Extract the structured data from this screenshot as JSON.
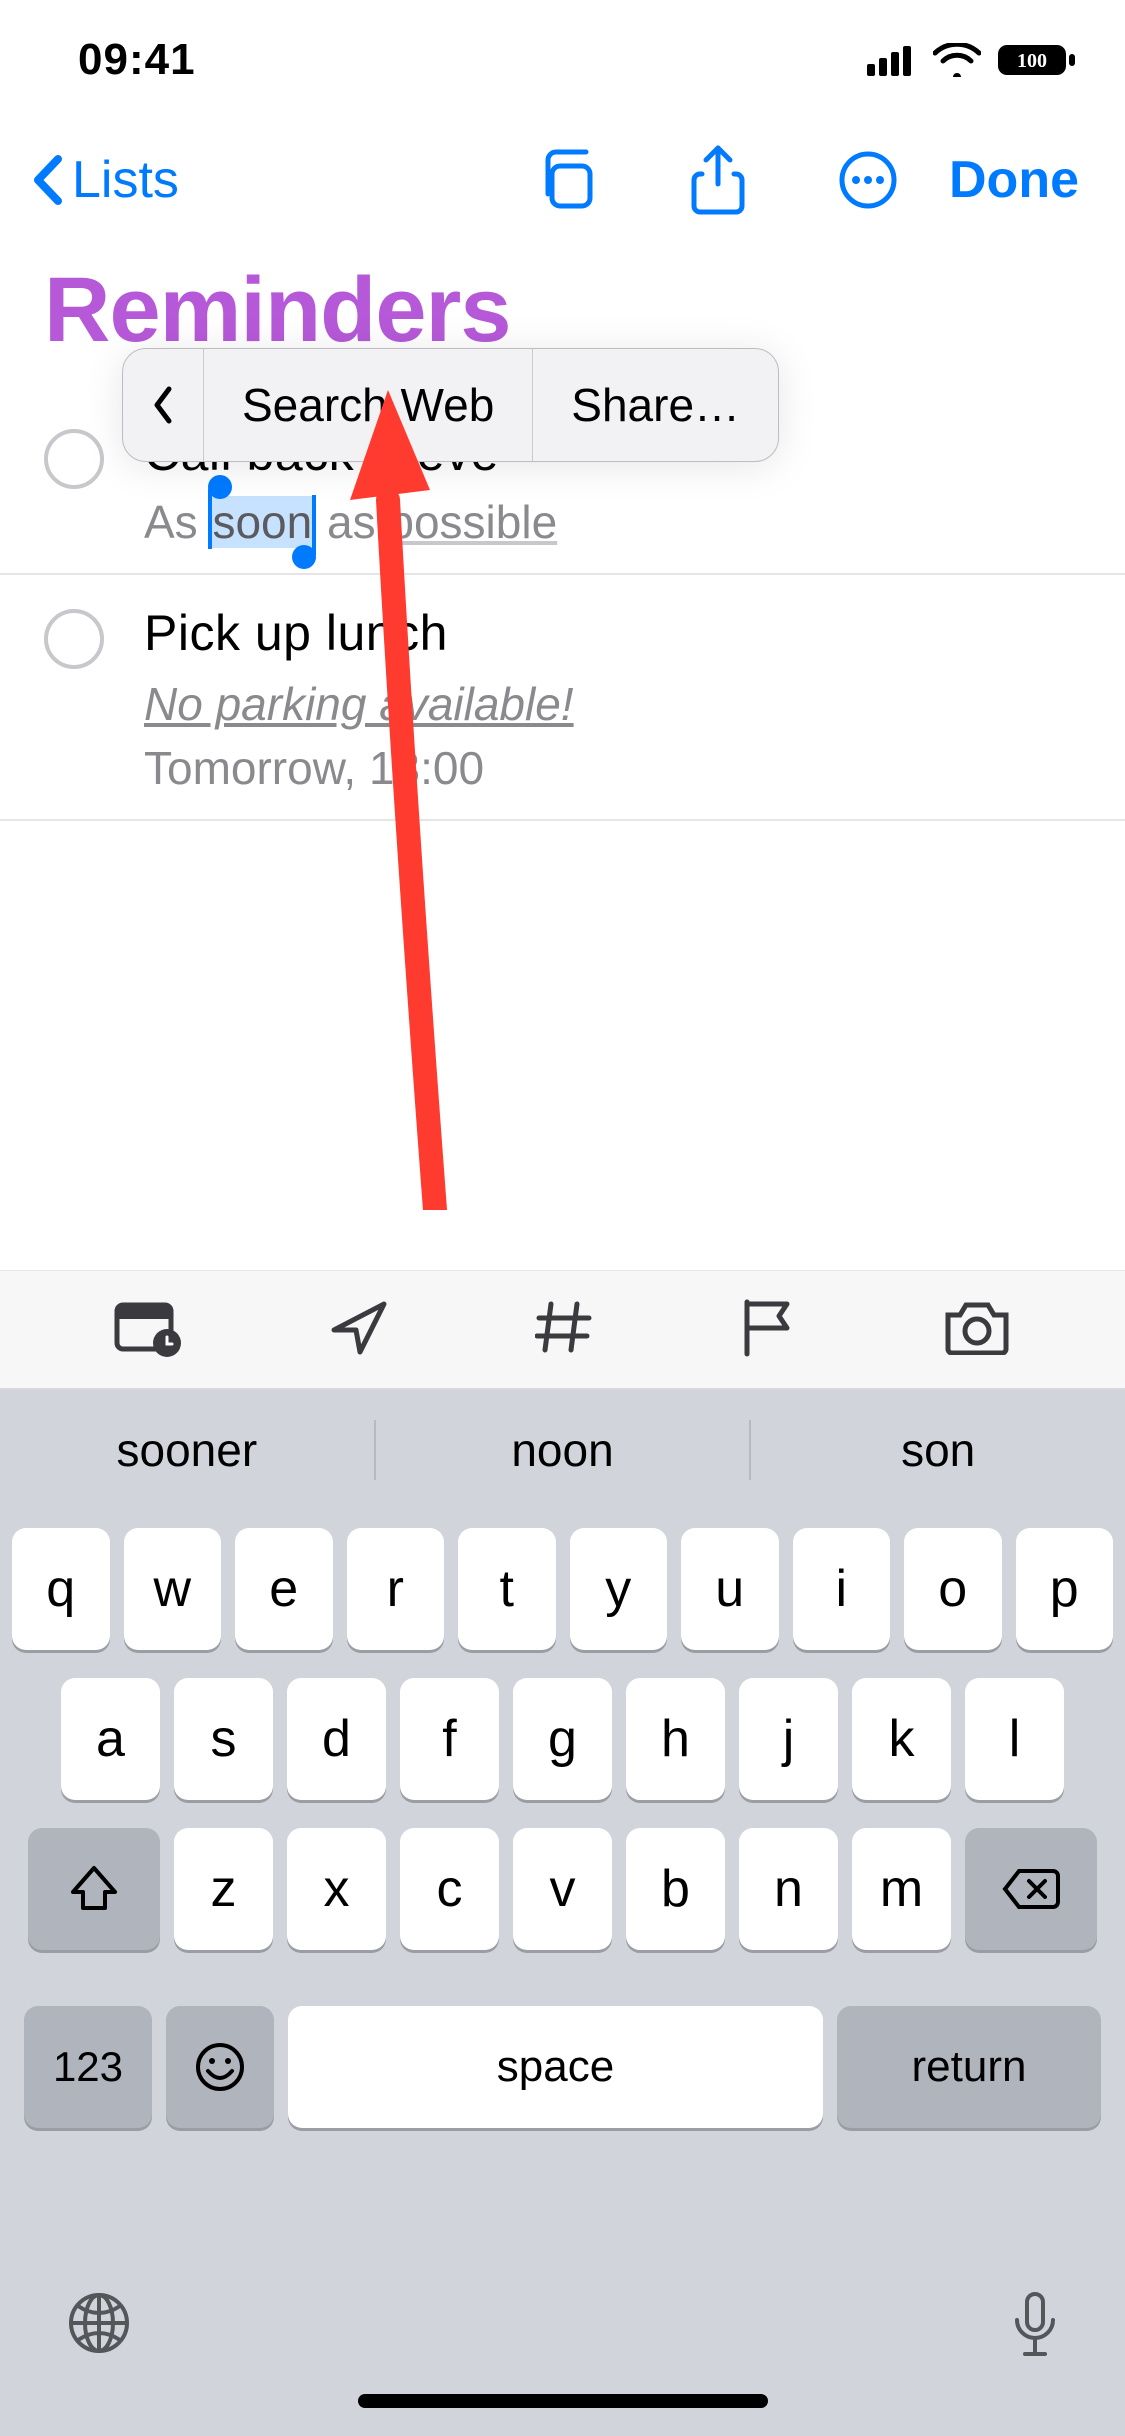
{
  "status": {
    "time": "09:41",
    "battery": "100"
  },
  "nav": {
    "back_label": "Lists",
    "done_label": "Done"
  },
  "title": "Reminders",
  "context_menu": {
    "item1": "Search Web",
    "item2": "Share…"
  },
  "reminders": [
    {
      "title": "Call back Steve",
      "sub_before": "As ",
      "sub_selected": "soon",
      "sub_after_plain": " as ",
      "sub_after_underlined": "possible"
    },
    {
      "title": "Pick up lunch",
      "note": "No parking available!",
      "date": "Tomorrow, 13:00"
    }
  ],
  "suggestions": {
    "s1": "sooner",
    "s2": "noon",
    "s3": "son"
  },
  "keys": {
    "row1": [
      "q",
      "w",
      "e",
      "r",
      "t",
      "y",
      "u",
      "i",
      "o",
      "p"
    ],
    "row2": [
      "a",
      "s",
      "d",
      "f",
      "g",
      "h",
      "j",
      "k",
      "l"
    ],
    "row3": [
      "z",
      "x",
      "c",
      "v",
      "b",
      "n",
      "m"
    ],
    "num": "123",
    "space": "space",
    "return": "return"
  }
}
